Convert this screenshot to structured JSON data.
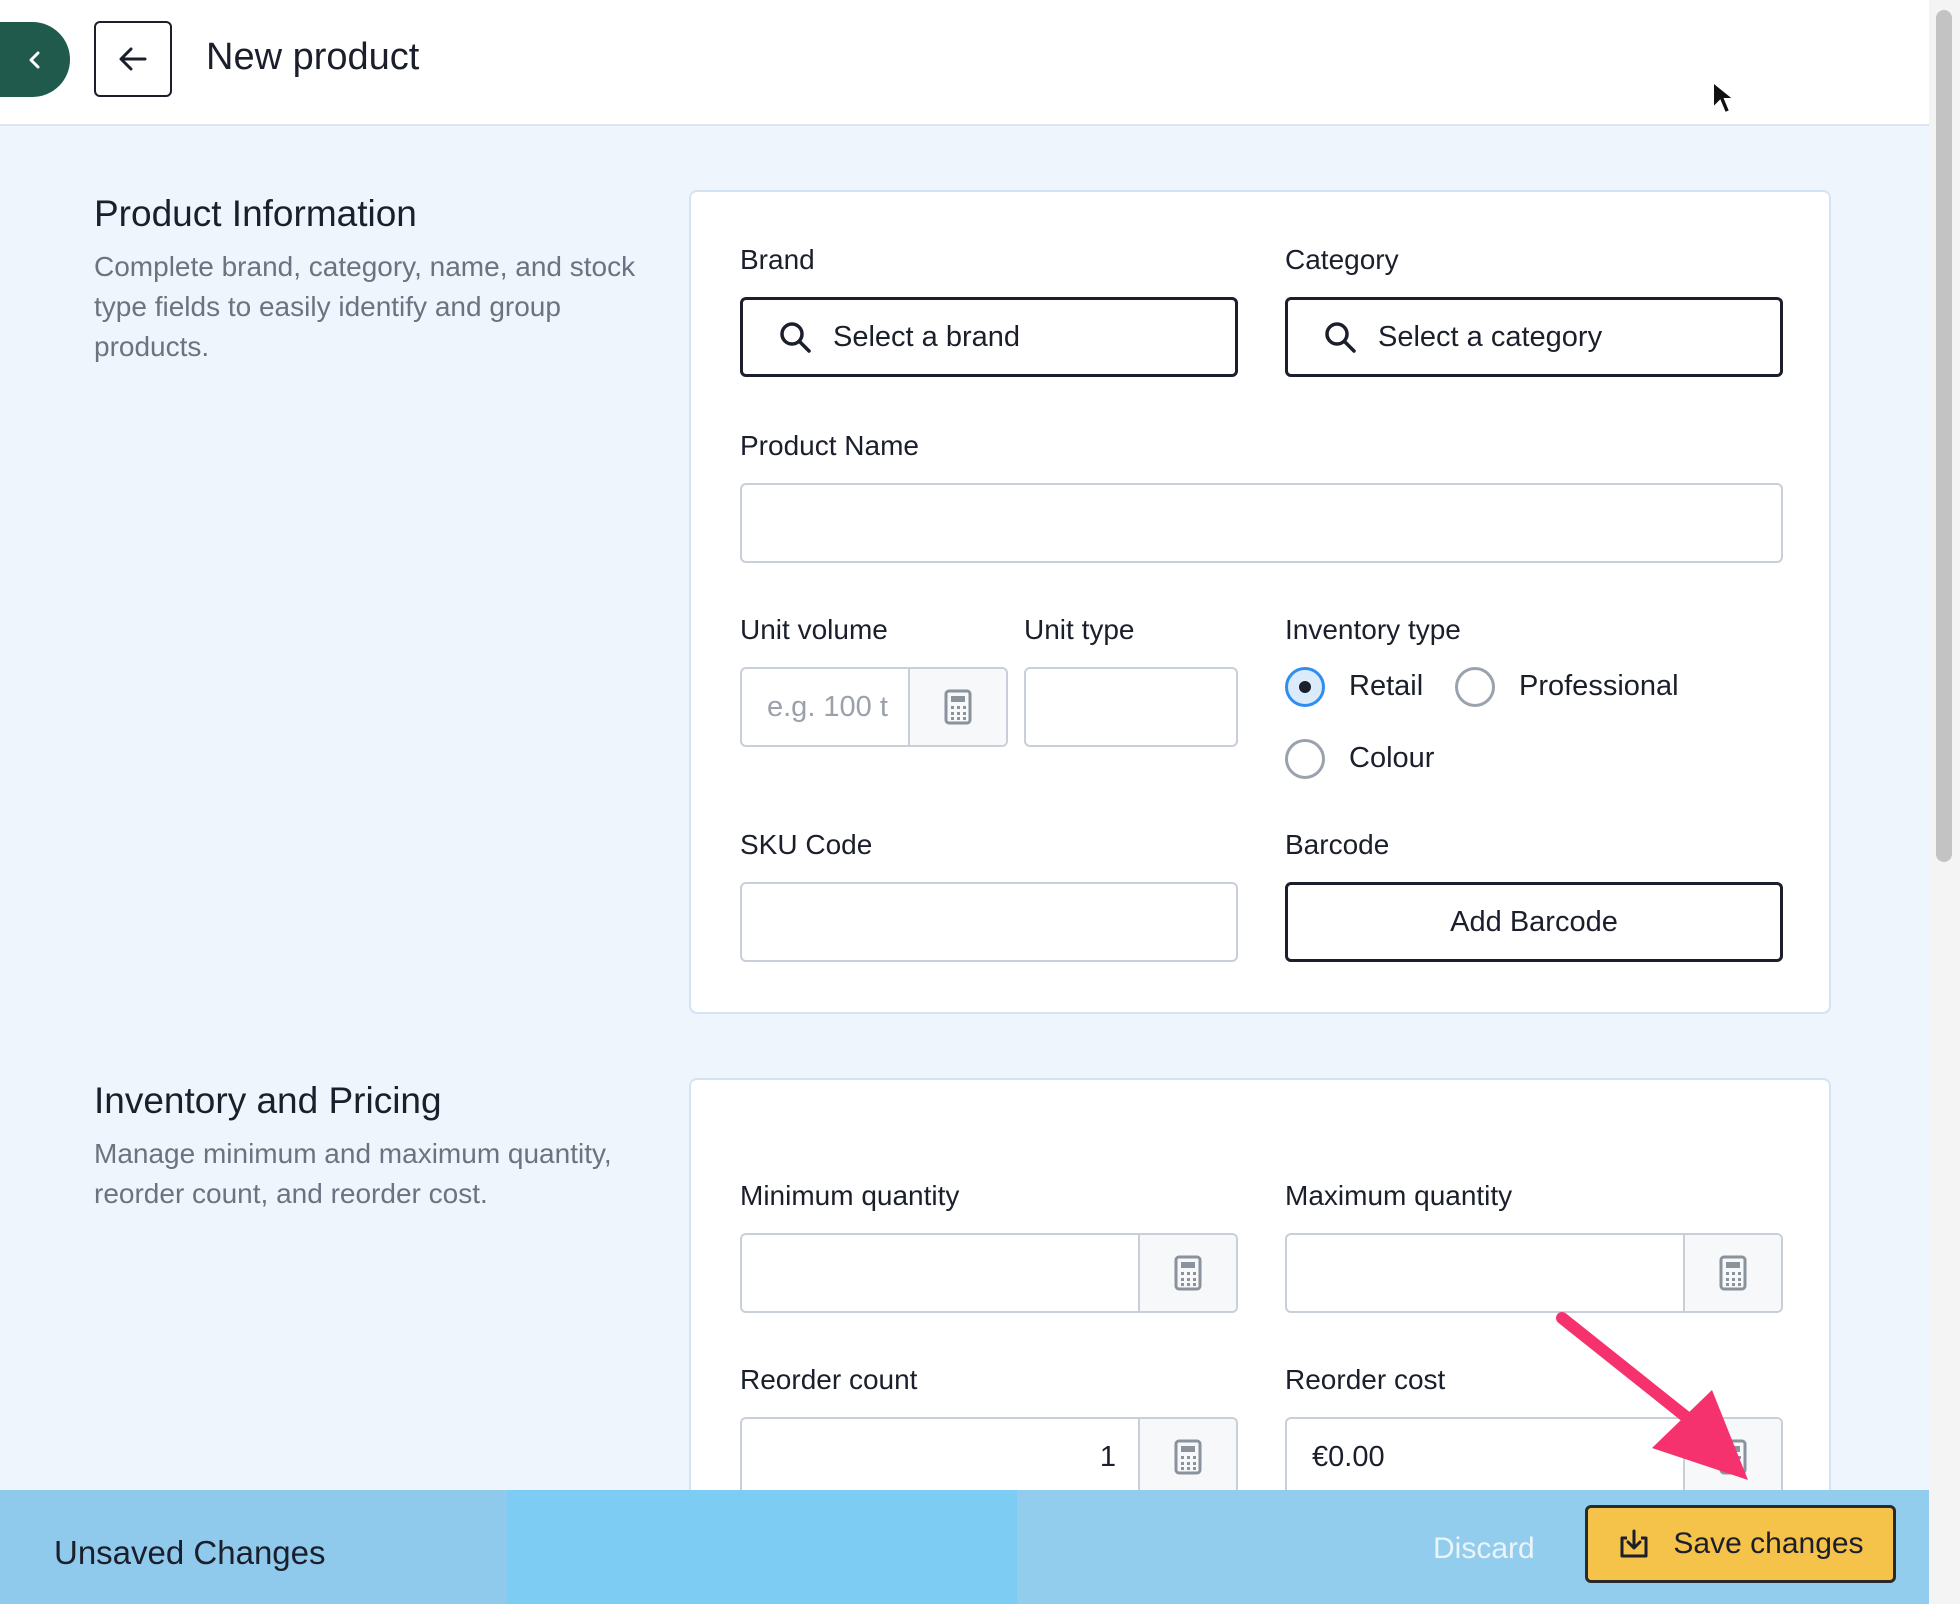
{
  "header": {
    "title": "New product"
  },
  "product_info": {
    "title": "Product Information",
    "description": "Complete brand, category, name, and stock type fields to easily identify and group products.",
    "brand": {
      "label": "Brand",
      "placeholder": "Select a brand"
    },
    "category": {
      "label": "Category",
      "placeholder": "Select a category"
    },
    "product_name": {
      "label": "Product Name",
      "value": ""
    },
    "unit_volume": {
      "label": "Unit volume",
      "placeholder": "e.g. 100 t"
    },
    "unit_type": {
      "label": "Unit type",
      "value": ""
    },
    "inventory_type": {
      "label": "Inventory type",
      "options": [
        "Retail",
        "Professional",
        "Colour"
      ],
      "selected": "Retail"
    },
    "sku": {
      "label": "SKU Code",
      "value": ""
    },
    "barcode": {
      "label": "Barcode",
      "button": "Add Barcode"
    }
  },
  "inventory": {
    "title": "Inventory and Pricing",
    "description": "Manage minimum and maximum quantity, reorder count, and reorder cost.",
    "min_qty": {
      "label": "Minimum quantity",
      "value": ""
    },
    "max_qty": {
      "label": "Maximum quantity",
      "value": ""
    },
    "reorder_count": {
      "label": "Reorder count",
      "value": "1"
    },
    "reorder_cost": {
      "label": "Reorder cost",
      "value": "€0.00"
    }
  },
  "footer": {
    "status": "Unsaved Changes",
    "discard": "Discard",
    "save": "Save changes"
  },
  "colors": {
    "accent_green": "#1f5a4c",
    "save_button": "#f5c24a",
    "footer_bar": "#93cdee",
    "annotation_arrow": "#f5326e"
  }
}
